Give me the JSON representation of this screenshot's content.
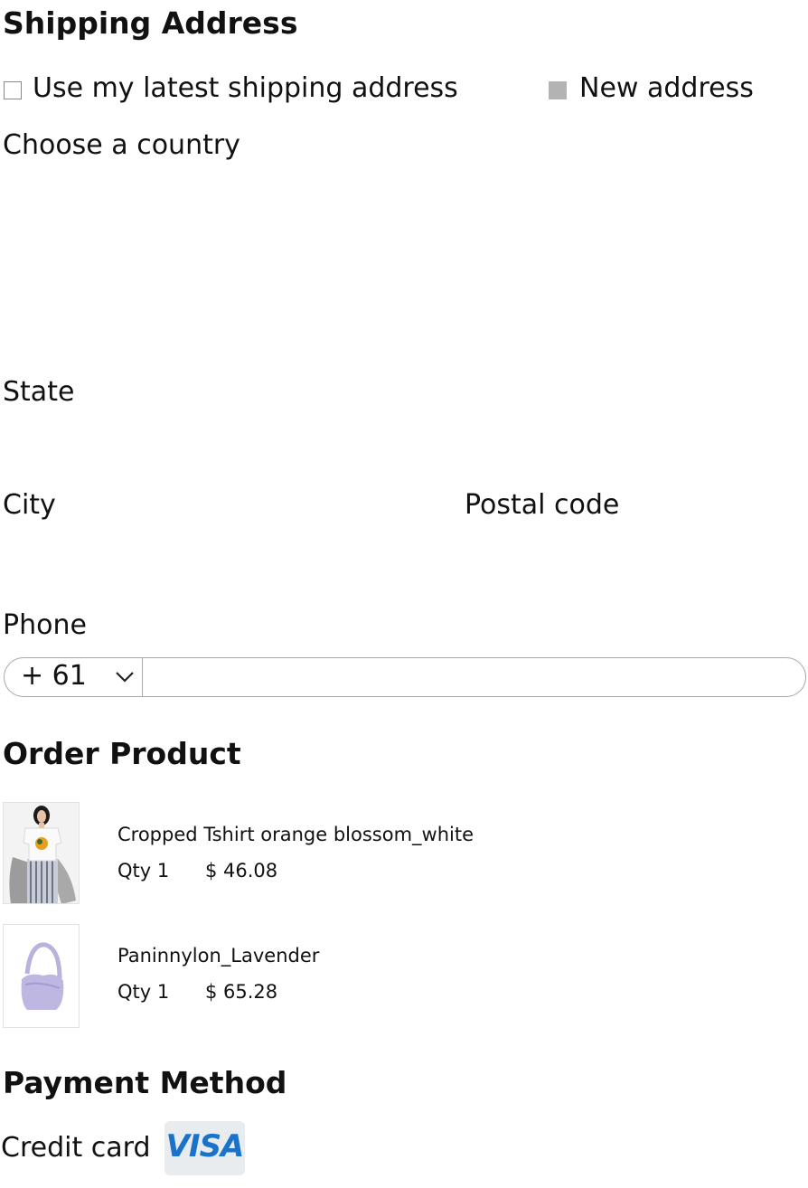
{
  "shipping": {
    "title": "Shipping Address",
    "use_latest_label": "Use my latest shipping address",
    "use_latest_checked": false,
    "new_address_label": "New address",
    "new_address_checked": true,
    "country_label": "Choose a country",
    "state_label": "State",
    "city_label": "City",
    "postal_label": "Postal code",
    "phone_label": "Phone",
    "phone_code": "+ 61",
    "phone_value": ""
  },
  "order": {
    "title": "Order Product",
    "items": [
      {
        "name": "Cropped Tshirt orange blossom_white",
        "qty": "Qty 1",
        "price": "$ 46.08",
        "image": "tshirt-product-image"
      },
      {
        "name": "Paninnylon_Lavender",
        "qty": "Qty 1",
        "price": "$ 65.28",
        "image": "lavender-bag-product-image"
      }
    ]
  },
  "payment": {
    "title": "Payment Method",
    "method_label": "Credit card",
    "card_brand": "VISA",
    "card_color": "#1a73c9"
  }
}
